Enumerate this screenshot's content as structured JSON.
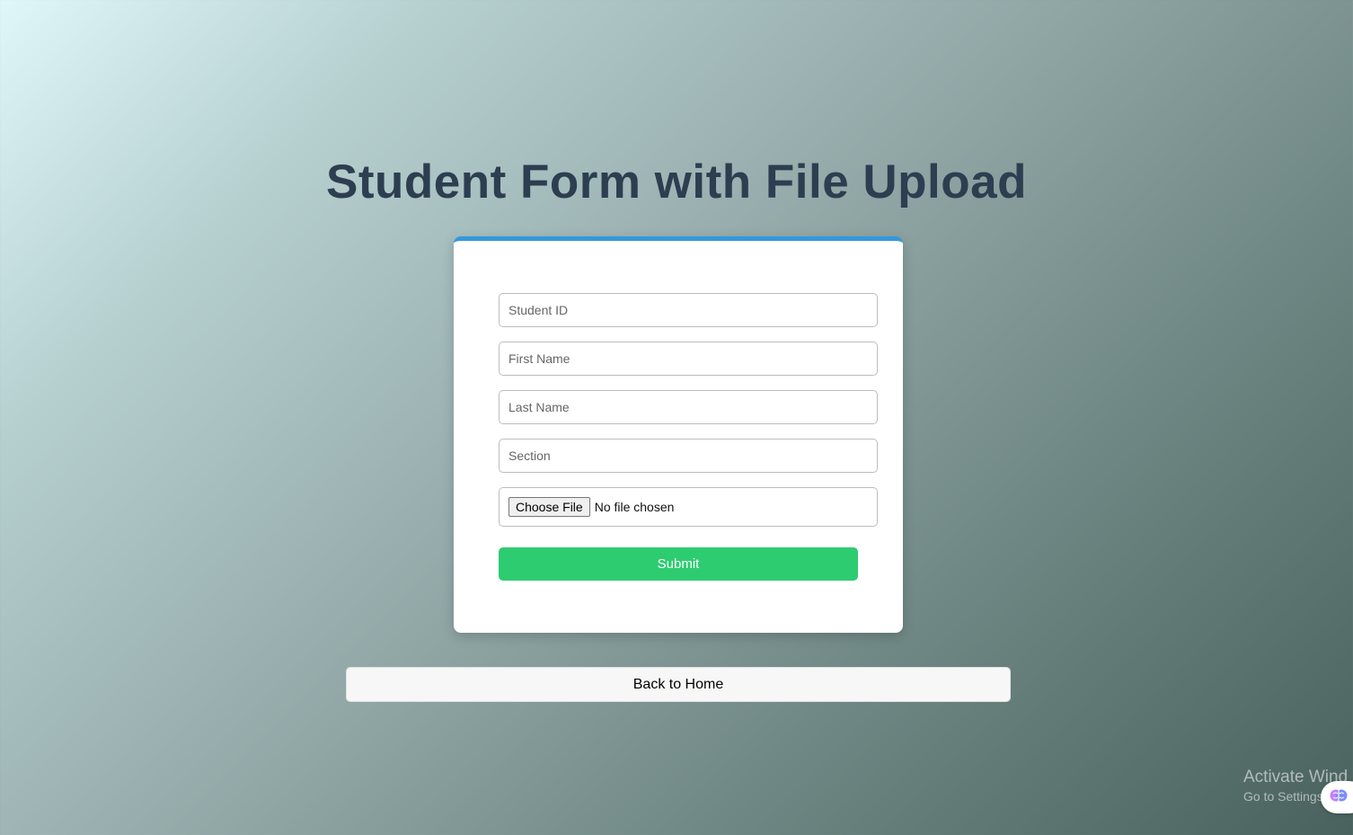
{
  "page": {
    "title": "Student Form with File Upload"
  },
  "form": {
    "student_id_placeholder": "Student ID",
    "first_name_placeholder": "First Name",
    "last_name_placeholder": "Last Name",
    "section_placeholder": "Section",
    "choose_file_label": "Choose File",
    "file_status": "No file chosen",
    "submit_label": "Submit"
  },
  "nav": {
    "back_label": "Back to Home"
  },
  "watermark": {
    "title": "Activate Wind",
    "subtitle": "Go to Settings"
  },
  "widget": {
    "icon": "brain-icon"
  },
  "colors": {
    "title": "#2c3e50",
    "card_accent": "#3498db",
    "submit": "#2ecc71"
  }
}
